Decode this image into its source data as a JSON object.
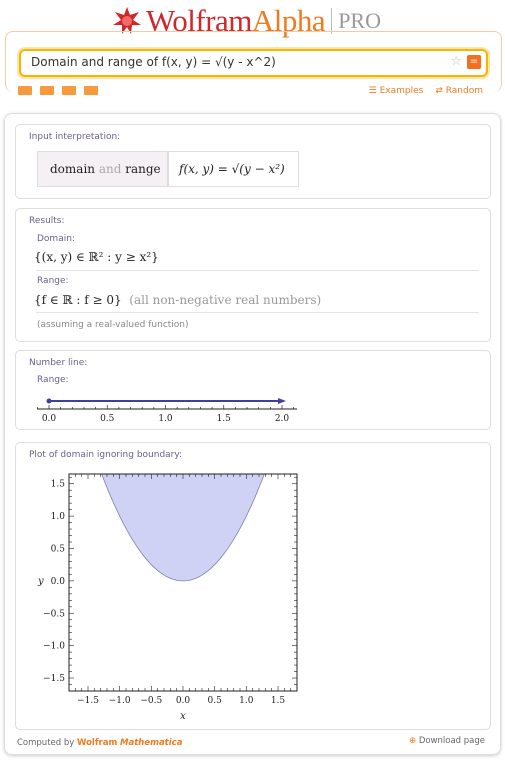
{
  "header": {
    "logo_wolfram": "Wolfram",
    "logo_alpha": "Alpha",
    "logo_pro": "PRO"
  },
  "search": {
    "value": "Domain and range of f(x, y) = √(y - x^2)",
    "examples": "Examples",
    "random": "Random"
  },
  "pods": {
    "input": {
      "title": "Input interpretation:",
      "left_a": "domain",
      "left_and": "and",
      "left_b": "range",
      "formula": "f(x, y) = √(y − x²)"
    },
    "results": {
      "title": "Results:",
      "domain_label": "Domain:",
      "domain": "{(x, y) ∈ ℝ² : y ≥ x²}",
      "range_label": "Range:",
      "range": "{f ∈ ℝ : f ≥ 0}",
      "range_note": "(all non-negative real numbers)",
      "assumption": "(assuming a real-valued function)"
    },
    "numberline": {
      "title": "Number line:",
      "sub": "Range:",
      "ticks": [
        "0.0",
        "0.5",
        "1.0",
        "1.5",
        "2.0"
      ],
      "start": 0,
      "closed_start": true,
      "color": "#3f3f9f"
    },
    "plot": {
      "title": "Plot of domain ignoring boundary:"
    }
  },
  "chart_data": {
    "type": "area",
    "description_region": "y >= x^2",
    "xlabel": "x",
    "ylabel": "y",
    "xlim": [
      -1.8,
      1.8
    ],
    "ylim": [
      -1.7,
      1.65
    ],
    "xticks": [
      "−1.5",
      "−1.0",
      "−0.5",
      "0.0",
      "0.5",
      "1.0",
      "1.5"
    ],
    "yticks": [
      "1.5",
      "1.0",
      "0.5",
      "0.0",
      "−0.5",
      "−1.0",
      "−1.5"
    ],
    "fill": "#cfd2f5",
    "stroke": "#7d80a8"
  },
  "footer": {
    "computed_by": "Computed by",
    "wolfram": "Wolfram",
    "mathematica": "Mathematica",
    "download": "Download page"
  }
}
